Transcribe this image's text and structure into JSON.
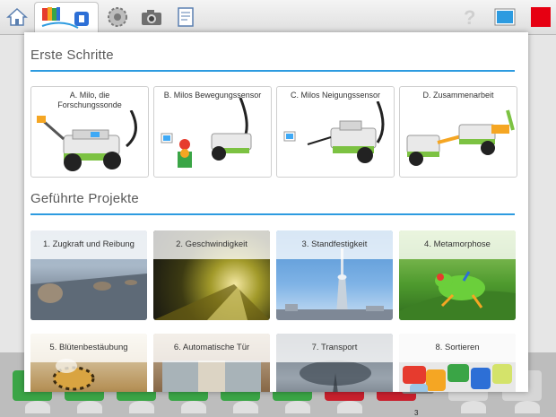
{
  "toolbar": {
    "items": [
      "home-icon",
      "getting-started-icon",
      "settings-icon",
      "camera-icon",
      "documentation-icon",
      "help-icon",
      "screen-icon",
      "stop-icon"
    ]
  },
  "bottom_counter": "3",
  "sections": {
    "getting_started": {
      "title": "Erste Schritte",
      "cards": [
        {
          "label": "A. Milo, die Forschungssonde"
        },
        {
          "label": "B. Milos Bewegungssensor"
        },
        {
          "label": "C. Milos Neigungssensor"
        },
        {
          "label": "D. Zusammenarbeit"
        }
      ]
    },
    "guided_projects": {
      "title": "Geführte Projekte",
      "cards": [
        {
          "label": "1. Zugkraft und Reibung"
        },
        {
          "label": "2. Geschwindigkeit"
        },
        {
          "label": "3. Standfestigkeit"
        },
        {
          "label": "4. Metamorphose"
        },
        {
          "label": "5. Blütenbestäubung"
        },
        {
          "label": "6. Automatische Tür"
        },
        {
          "label": "7. Transport"
        },
        {
          "label": "8. Sortieren"
        }
      ]
    }
  },
  "colors": {
    "accent": "#2d9be0",
    "stop": "#e60012",
    "lego_green": "#7cc242"
  }
}
